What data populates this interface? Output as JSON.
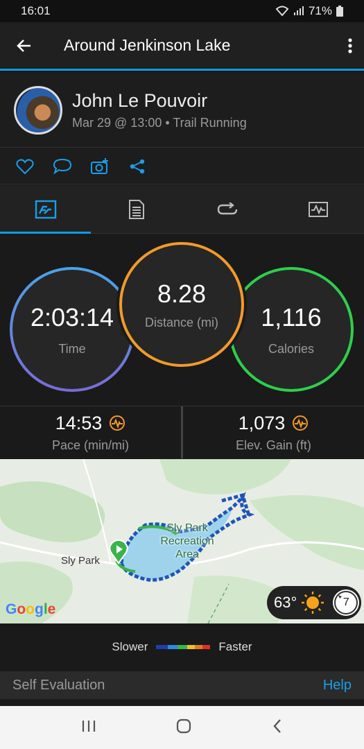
{
  "status_bar": {
    "time": "16:01",
    "battery": "71%"
  },
  "header": {
    "title": "Around Jenkinson Lake"
  },
  "profile": {
    "name": "John Le Pouvoir",
    "subtitle": "Mar 29 @ 13:00 • Trail Running"
  },
  "rings": {
    "time": {
      "value": "2:03:14",
      "label": "Time"
    },
    "distance": {
      "value": "8.28",
      "label": "Distance (mi)"
    },
    "calories": {
      "value": "1,116",
      "label": "Calories"
    }
  },
  "stats": {
    "pace": {
      "value": "14:53",
      "label": "Pace (min/mi)"
    },
    "elevation": {
      "value": "1,073",
      "label": "Elev. Gain (ft)"
    }
  },
  "map": {
    "place_label": "Sly Park",
    "recreation_label_1": "Sly Park",
    "recreation_label_2": "Recreation",
    "recreation_label_3": "Area",
    "logo": "Google",
    "temperature": "63°",
    "wind_speed": "7"
  },
  "legend": {
    "slower": "Slower",
    "faster": "Faster"
  },
  "self_evaluation": {
    "label": "Self Evaluation",
    "help": "Help"
  },
  "colors": {
    "accent": "#0b9ce5",
    "time_ring": "#4aa3e8",
    "distance_ring": "#f39a2b",
    "calories_ring": "#2dcf4c"
  }
}
